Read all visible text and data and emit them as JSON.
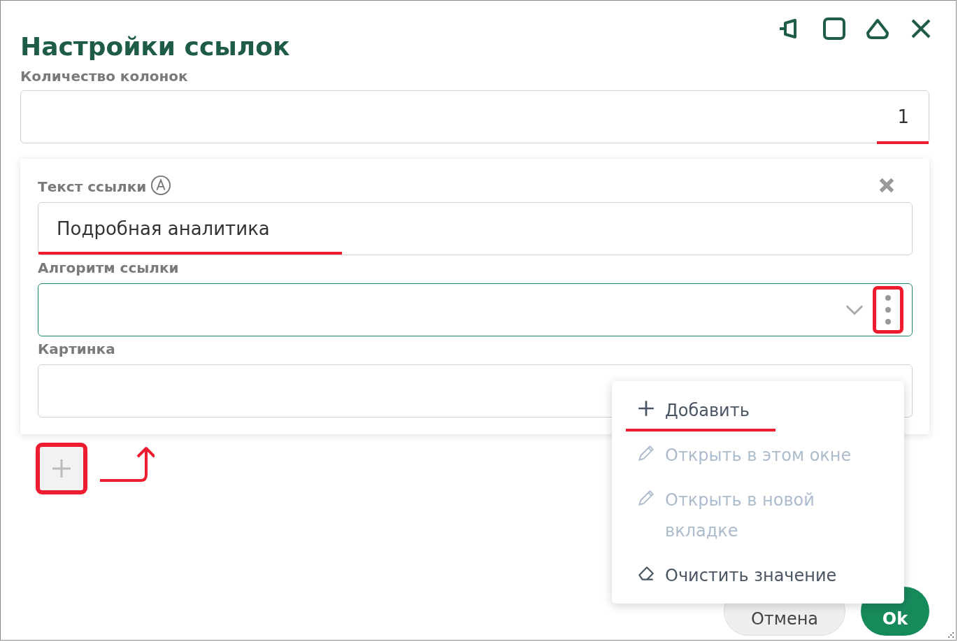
{
  "dialog": {
    "title": "Настройки ссылок"
  },
  "columns_field": {
    "label": "Количество колонок",
    "value": "1"
  },
  "link_card": {
    "text_field": {
      "label": "Текст ссылки",
      "value": "Подробная аналитика"
    },
    "algorithm_field": {
      "label": "Алгоритм ссылки",
      "focused": true
    },
    "image_field": {
      "label": "Картинка"
    }
  },
  "context_menu": [
    {
      "label": "Добавить",
      "kind": "add",
      "disabled": false
    },
    {
      "label": "Открыть в этом окне",
      "kind": "edit",
      "disabled": true
    },
    {
      "label": "Открыть в новой вкладке",
      "kind": "edit",
      "disabled": true
    },
    {
      "label": "Очистить значение",
      "kind": "clear",
      "disabled": false
    }
  ],
  "buttons": [
    {
      "label": "Отмена",
      "kind": "secondary"
    },
    {
      "label": "Ok",
      "kind": "primary"
    }
  ]
}
